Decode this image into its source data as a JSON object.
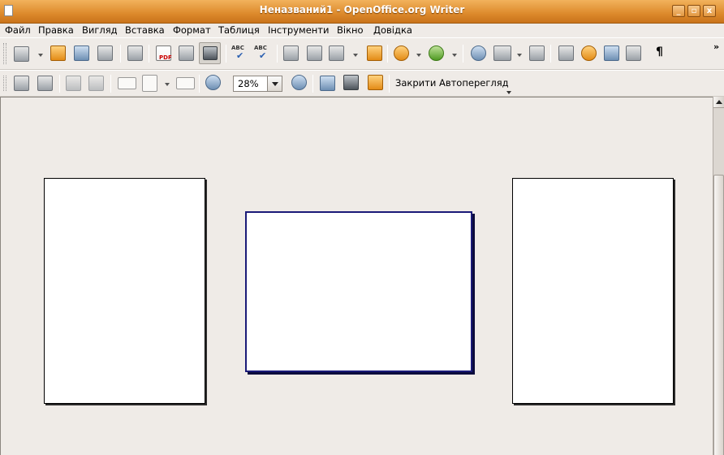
{
  "window": {
    "title": "Неназваний1 - OpenOffice.org Writer",
    "minimize": "_",
    "maximize": "▫",
    "close": "x"
  },
  "menu": {
    "items": [
      "Файл",
      "Правка",
      "Вигляд",
      "Вставка",
      "Формат",
      "Таблиця",
      "Інструменти",
      "Вікно",
      "Довідка"
    ]
  },
  "toolbar1": {
    "spell_label": "ABC",
    "autospell_label": "ABC",
    "pdf_label": "PDF",
    "nonprinting_glyph": "¶",
    "overflow_glyph": "»"
  },
  "preview_toolbar": {
    "zoom_value": "28%",
    "close_preview_label": "Закрити Автоперегляд"
  },
  "colors": {
    "titlebar": "#dd8a2c",
    "selected_page_border": "#1a1a78",
    "workspace": "#efebe7"
  }
}
